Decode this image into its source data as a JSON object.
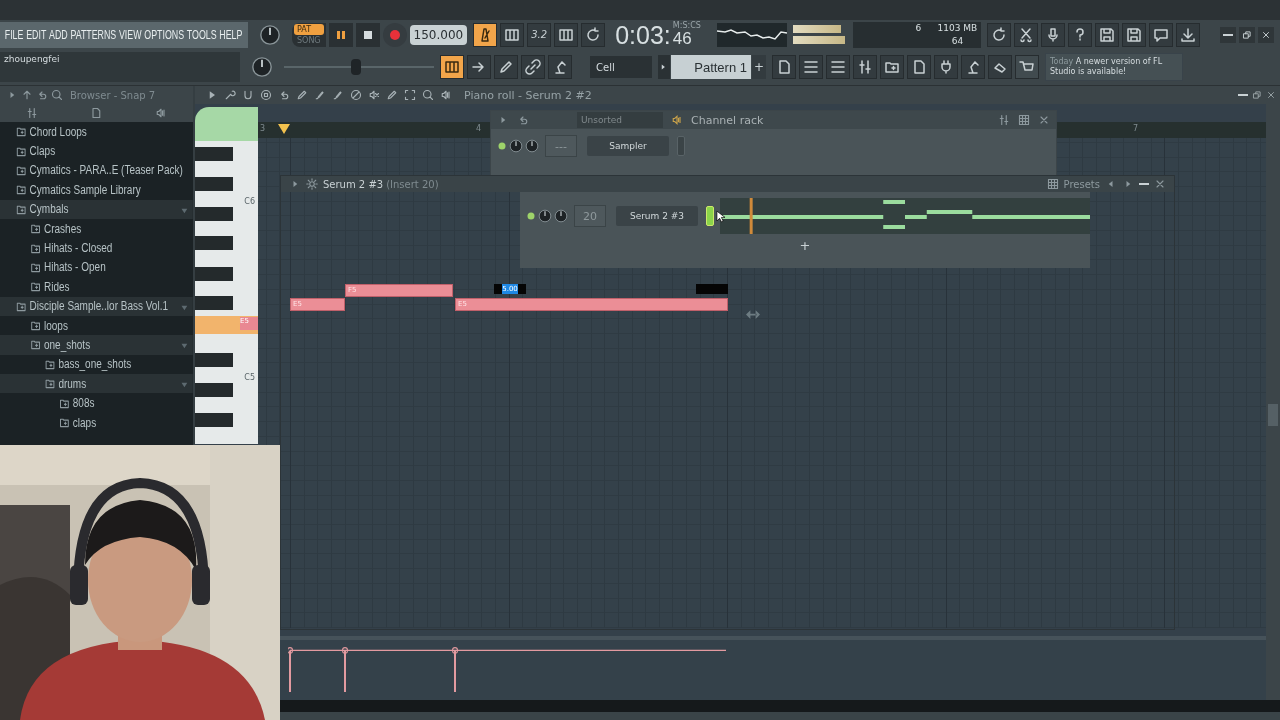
{
  "menu": [
    "FILE",
    "EDIT",
    "ADD",
    "PATTERNS",
    "VIEW",
    "OPTIONS",
    "TOOLS",
    "HELP"
  ],
  "hint": "zhoupengfei",
  "transport": {
    "modes": [
      {
        "label": "PAT",
        "selected": true
      },
      {
        "label": "SONG",
        "selected": false
      }
    ],
    "tempo": "150.000",
    "countdown": "3.2",
    "time": "0:03:",
    "time_cs": "46",
    "time_unit": "M:S:CS"
  },
  "cpu": {
    "voices": "6",
    "memory": "1103 MB",
    "polyphony": "64"
  },
  "pitch": {
    "level": 0.48
  },
  "snap": "Cell",
  "pattern": "Pattern 1",
  "pattern_add": "+",
  "news": {
    "when": "Today",
    "text": "A newer version of FL Studio is available!"
  },
  "browser": {
    "title": "Browser - Snap 7",
    "items": [
      {
        "label": "Chord Loops",
        "expanded": false
      },
      {
        "label": "Claps",
        "expanded": false
      },
      {
        "label": "Cymatics - PARA..E (Teaser Pack)",
        "expanded": false
      },
      {
        "label": "Cymatics Sample Library",
        "expanded": false
      },
      {
        "label": "Cymbals",
        "expanded": true,
        "children": [
          {
            "label": "Crashes",
            "expanded": false
          },
          {
            "label": "Hihats - Closed",
            "expanded": false
          },
          {
            "label": "Hihats - Open",
            "expanded": false
          },
          {
            "label": "Rides",
            "expanded": false
          }
        ]
      },
      {
        "label": "Disciple Sample..lor Bass Vol.1",
        "expanded": true,
        "children": [
          {
            "label": "loops",
            "expanded": false
          },
          {
            "label": "one_shots",
            "expanded": true,
            "children": [
              {
                "label": "bass_one_shots",
                "expanded": false
              },
              {
                "label": "drums",
                "expanded": true,
                "children": [
                  {
                    "label": "808s",
                    "expanded": false
                  },
                  {
                    "label": "claps",
                    "expanded": false
                  }
                ]
              }
            ]
          }
        ]
      }
    ]
  },
  "piano_roll": {
    "title": "Piano roll - Serum 2 #2",
    "key_labels": [
      "C6",
      "C5"
    ],
    "active_key": "E5",
    "bars": [
      "3",
      "4",
      "7"
    ],
    "notes": [
      {
        "label": "E5"
      },
      {
        "label": "F5"
      },
      {
        "label": "E5"
      }
    ],
    "popup": "5.00"
  },
  "channel_rack": {
    "group": "Unsorted",
    "title": "Channel rack",
    "channels": [
      {
        "number": "---",
        "name": "Sampler",
        "selected": false
      },
      {
        "number": "20",
        "name": "Serum 2 #3",
        "selected": true
      }
    ],
    "add": "+"
  },
  "plugin": {
    "name": "Serum 2 #3",
    "insert": "(Insert 20)",
    "presets": "Presets"
  }
}
